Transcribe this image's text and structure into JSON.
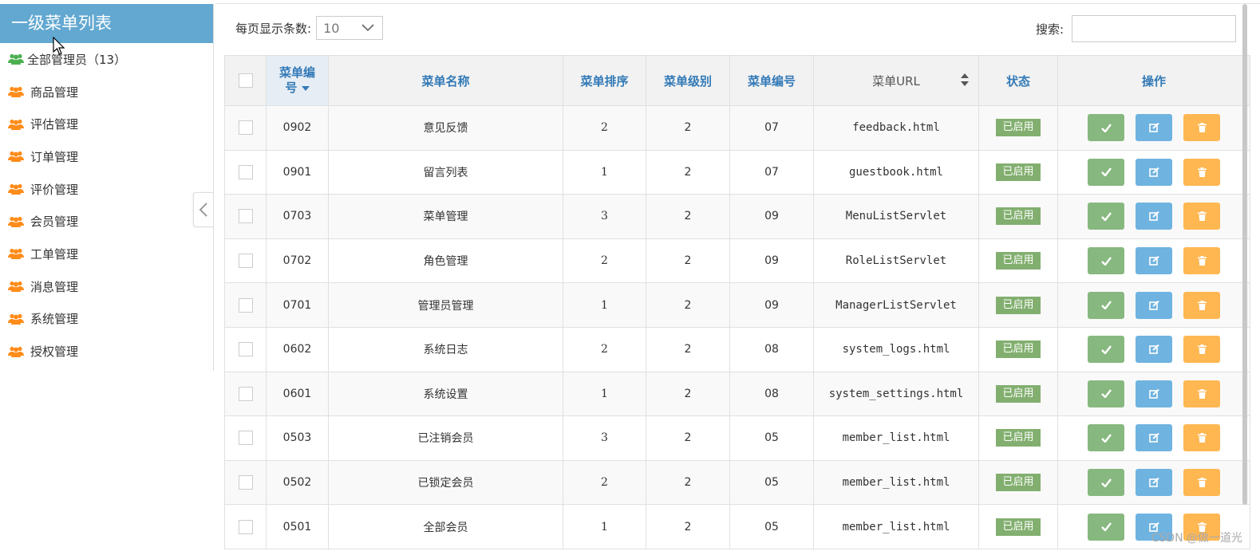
{
  "sidebar": {
    "title": "一级菜单列表",
    "items": [
      {
        "label": "全部管理员（13）",
        "icon": "users-icon",
        "color": "#4caf50"
      },
      {
        "label": "商品管理",
        "icon": "users-icon",
        "color": "#ff8c1a"
      },
      {
        "label": "评估管理",
        "icon": "users-icon",
        "color": "#ff8c1a"
      },
      {
        "label": "订单管理",
        "icon": "users-icon",
        "color": "#ff8c1a"
      },
      {
        "label": "评价管理",
        "icon": "users-icon",
        "color": "#ff8c1a"
      },
      {
        "label": "会员管理",
        "icon": "users-icon",
        "color": "#ff8c1a"
      },
      {
        "label": "工单管理",
        "icon": "users-icon",
        "color": "#ff8c1a"
      },
      {
        "label": "消息管理",
        "icon": "users-icon",
        "color": "#ff8c1a"
      },
      {
        "label": "系统管理",
        "icon": "users-icon",
        "color": "#ff8c1a"
      },
      {
        "label": "授权管理",
        "icon": "users-icon",
        "color": "#ff8c1a"
      }
    ]
  },
  "toolbar": {
    "page_size_label": "每页显示条数:",
    "page_size_value": "10",
    "search_label": "搜索:",
    "search_value": ""
  },
  "table": {
    "headers": {
      "id": "菜单编号",
      "name": "菜单名称",
      "order": "菜单排序",
      "level": "菜单级别",
      "code": "菜单编号",
      "url": "菜单URL",
      "status": "状态",
      "ops": "操作"
    },
    "rows": [
      {
        "id": "0902",
        "name": "意见反馈",
        "order": "2",
        "level": "2",
        "code": "07",
        "url": "feedback.html",
        "status": "已启用"
      },
      {
        "id": "0901",
        "name": "留言列表",
        "order": "1",
        "level": "2",
        "code": "07",
        "url": "guestbook.html",
        "status": "已启用"
      },
      {
        "id": "0703",
        "name": "菜单管理",
        "order": "3",
        "level": "2",
        "code": "09",
        "url": "MenuListServlet",
        "status": "已启用"
      },
      {
        "id": "0702",
        "name": "角色管理",
        "order": "2",
        "level": "2",
        "code": "09",
        "url": "RoleListServlet",
        "status": "已启用"
      },
      {
        "id": "0701",
        "name": "管理员管理",
        "order": "1",
        "level": "2",
        "code": "09",
        "url": "ManagerListServlet",
        "status": "已启用"
      },
      {
        "id": "0602",
        "name": "系统日志",
        "order": "2",
        "level": "2",
        "code": "08",
        "url": "system_logs.html",
        "status": "已启用"
      },
      {
        "id": "0601",
        "name": "系统设置",
        "order": "1",
        "level": "2",
        "code": "08",
        "url": "system_settings.html",
        "status": "已启用"
      },
      {
        "id": "0503",
        "name": "已注销会员",
        "order": "3",
        "level": "2",
        "code": "05",
        "url": "member_list.html",
        "status": "已启用"
      },
      {
        "id": "0502",
        "name": "已锁定会员",
        "order": "2",
        "level": "2",
        "code": "05",
        "url": "member_list.html",
        "status": "已启用"
      },
      {
        "id": "0501",
        "name": "全部会员",
        "order": "1",
        "level": "2",
        "code": "05",
        "url": "member_list.html",
        "status": "已启用"
      }
    ]
  },
  "colors": {
    "header_blue": "#62a8d1",
    "badge_green": "#82af6f",
    "btn_green": "#87b87f",
    "btn_blue": "#6fb3e0",
    "btn_orange": "#ffb752"
  },
  "watermark": "CSDN @做一道光"
}
